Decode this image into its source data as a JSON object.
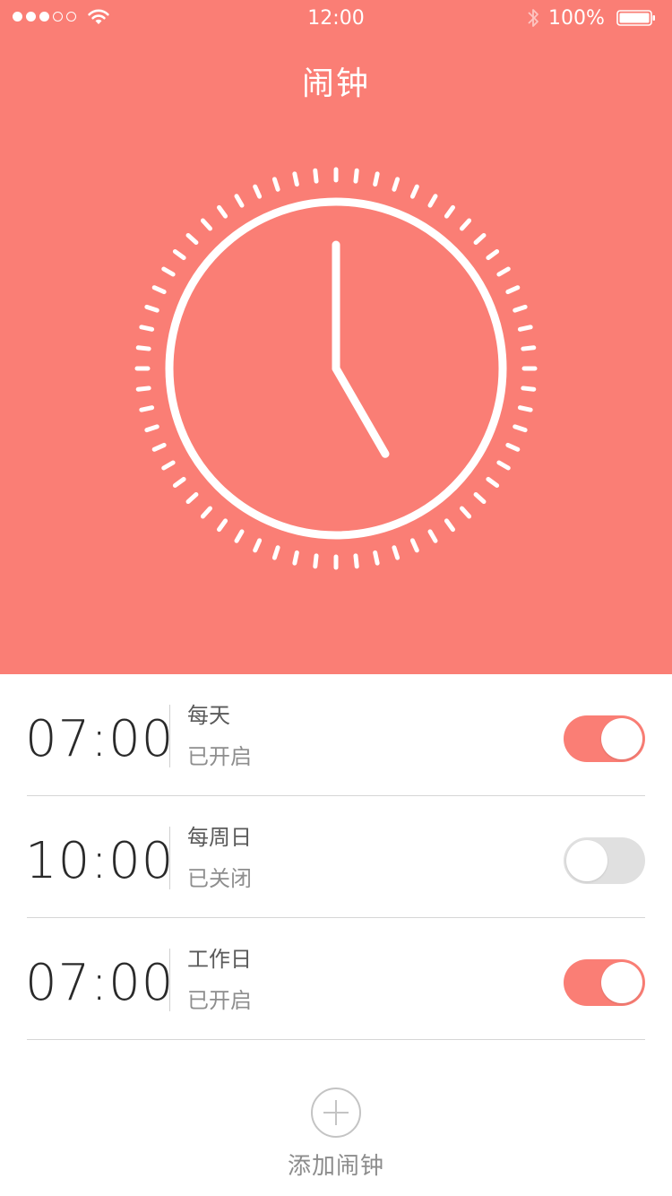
{
  "status_bar": {
    "time": "12:00",
    "battery_percent": "100%",
    "signal_filled": 3,
    "signal_total": 5
  },
  "header": {
    "title": "闹钟"
  },
  "clock": {
    "hour": 5,
    "minute": 0,
    "tick_count": 60
  },
  "alarms": [
    {
      "time": "07:00",
      "repeat": "每天",
      "status": "已开启",
      "enabled": true
    },
    {
      "time": "10:00",
      "repeat": "每周日",
      "status": "已关闭",
      "enabled": false
    },
    {
      "time": "07:00",
      "repeat": "工作日",
      "status": "已开启",
      "enabled": true
    }
  ],
  "add_alarm": {
    "label": "添加闹钟"
  },
  "colors": {
    "accent": "#fa7e75",
    "toggle_off": "#e0e0e0"
  }
}
